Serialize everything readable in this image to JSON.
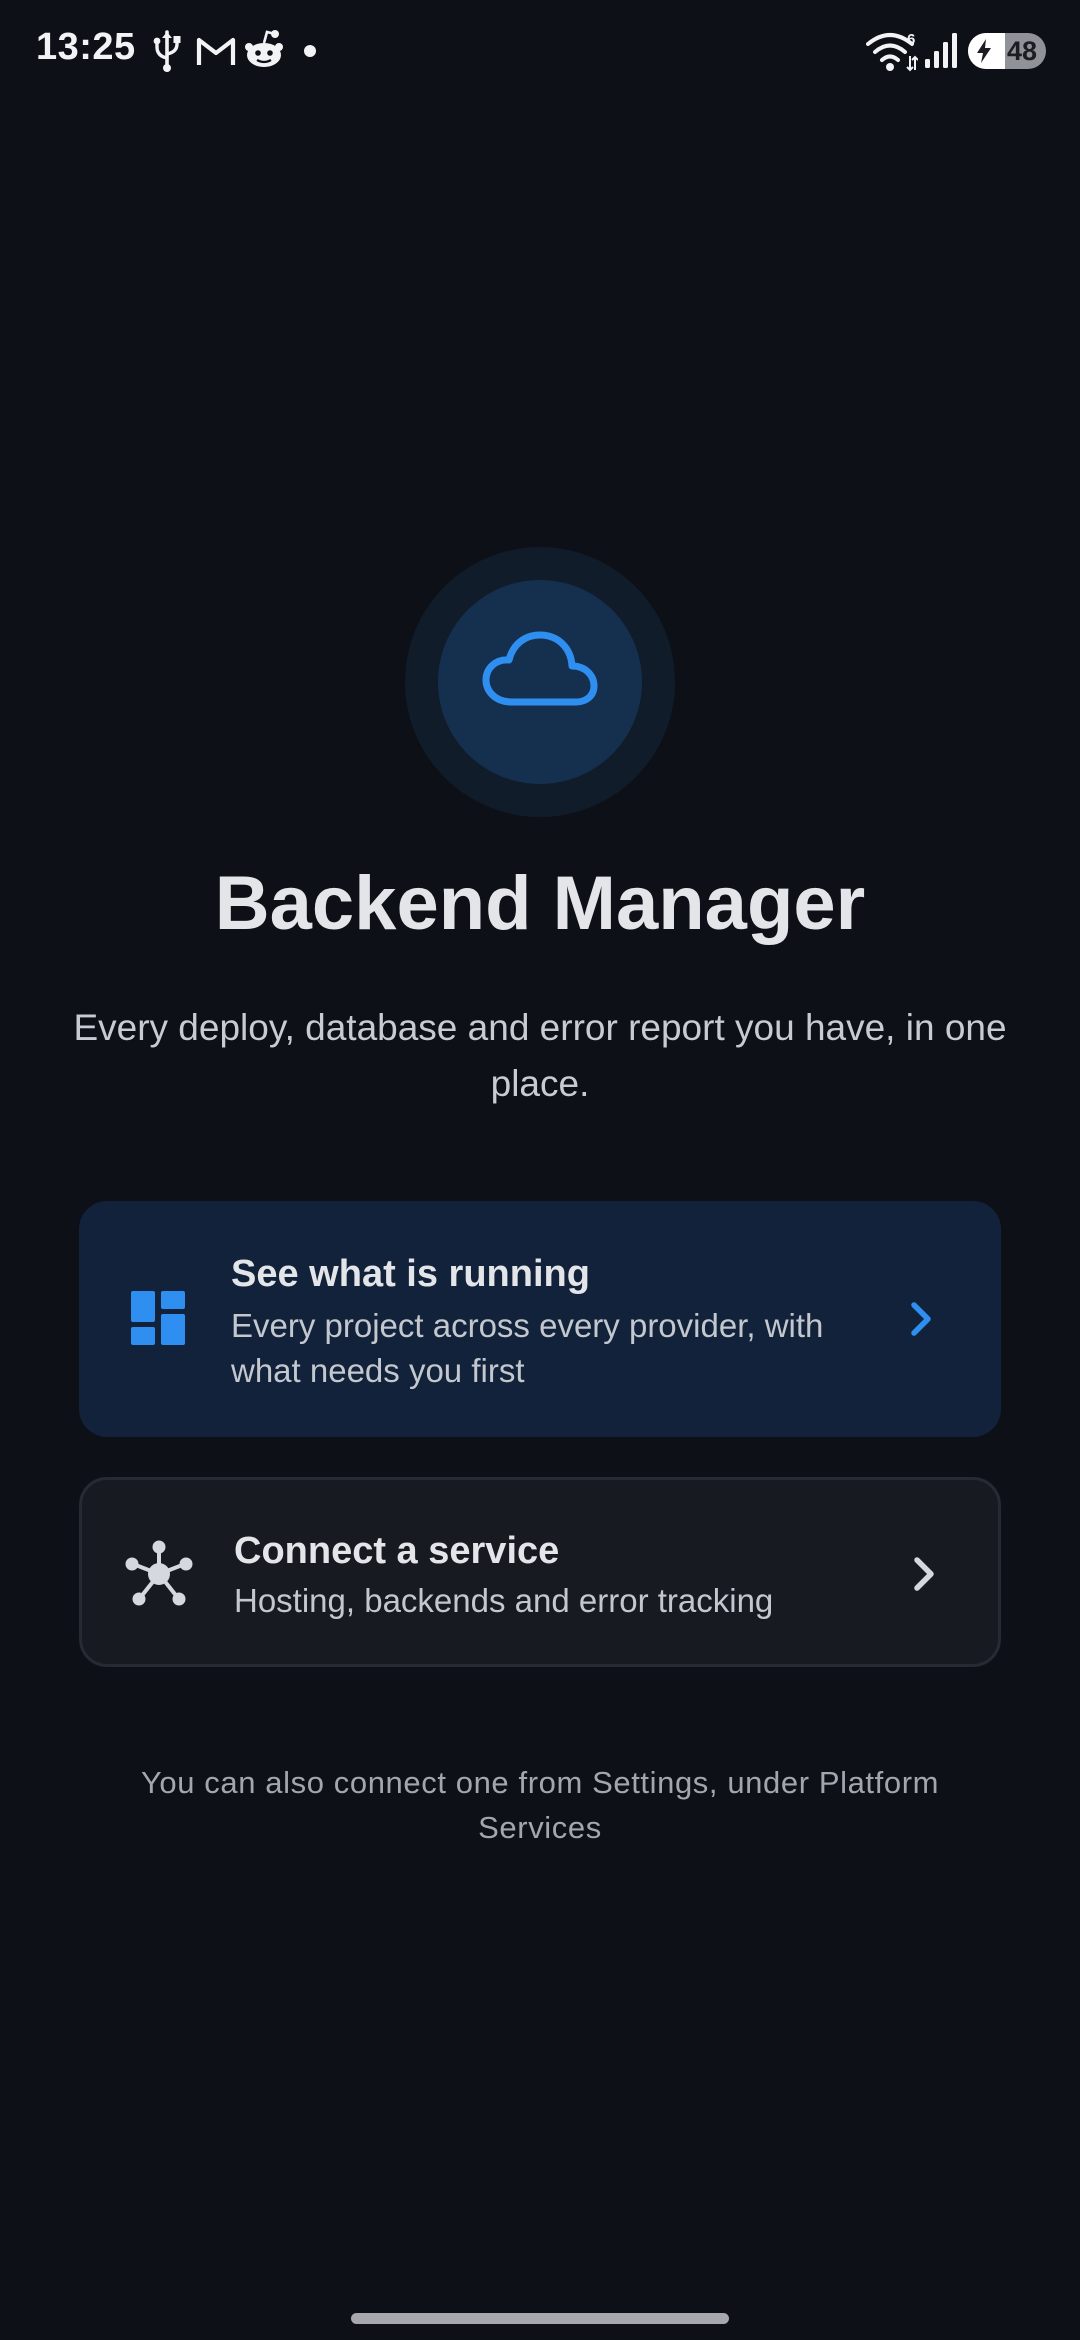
{
  "status_bar": {
    "time": "13:25",
    "battery_level": "48",
    "battery_fraction": 0.48,
    "wifi_badge": "6",
    "left_icons": [
      "usb-icon",
      "gmail-icon",
      "reddit-icon",
      "notification-dot-icon"
    ],
    "right_icons": [
      "wifi-icon",
      "signal-icon",
      "battery-charging-icon"
    ]
  },
  "hero": {
    "icon": "cloud-icon",
    "title": "Backend Manager",
    "subtitle": "Every deploy, database and error report you have, in one place."
  },
  "cards": [
    {
      "icon": "dashboard-icon",
      "title": "See what is running",
      "description": "Every project across every provider, with what needs you first",
      "chevron": "chevron-right-icon"
    },
    {
      "icon": "hub-icon",
      "title": "Connect a service",
      "description": "Hosting, backends and error tracking",
      "chevron": "chevron-right-icon"
    }
  ],
  "footer_note": "You can also connect one from Settings, under Platform Services",
  "colors": {
    "background": "#0d1017",
    "accent": "#2f8ff0",
    "primary_card": "#12223a",
    "secondary_card": "#171a21"
  }
}
